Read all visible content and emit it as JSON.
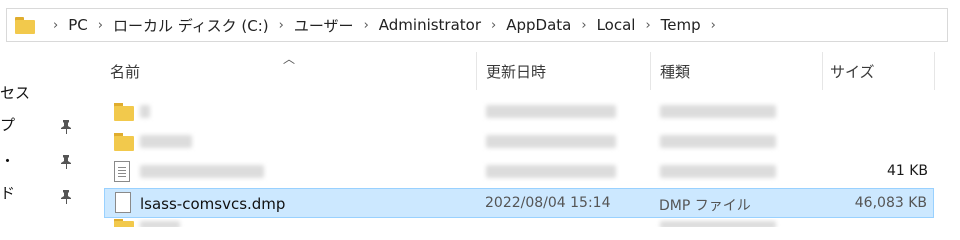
{
  "address_bar": {
    "crumbs": [
      "PC",
      "ローカル ディスク (C:)",
      "ユーザー",
      "Administrator",
      "AppData",
      "Local",
      "Temp"
    ]
  },
  "nav": {
    "fragments": [
      "セス",
      "プ",
      "・",
      "ド"
    ]
  },
  "columns": {
    "name": "名前",
    "date": "更新日時",
    "type": "種類",
    "size": "サイズ"
  },
  "files": [
    {
      "name": "",
      "date": "",
      "type": "",
      "size": "",
      "icon": "folder-icon",
      "blurred": true
    },
    {
      "name": "",
      "date": "",
      "type": "",
      "size": "",
      "icon": "folder-icon",
      "blurred": true
    },
    {
      "name": "",
      "date": "",
      "type": "",
      "size": "41 KB",
      "icon": "text-file-icon",
      "blurred": true
    },
    {
      "name": "lsass-comsvcs.dmp",
      "date": "2022/08/04 15:14",
      "type": "DMP ファイル",
      "size": "46,083 KB",
      "icon": "dmp-file-icon",
      "selected": true
    }
  ],
  "colors": {
    "selection_bg": "#cce8ff",
    "selection_border": "#99d1ff",
    "folder": "#f2c94c"
  }
}
